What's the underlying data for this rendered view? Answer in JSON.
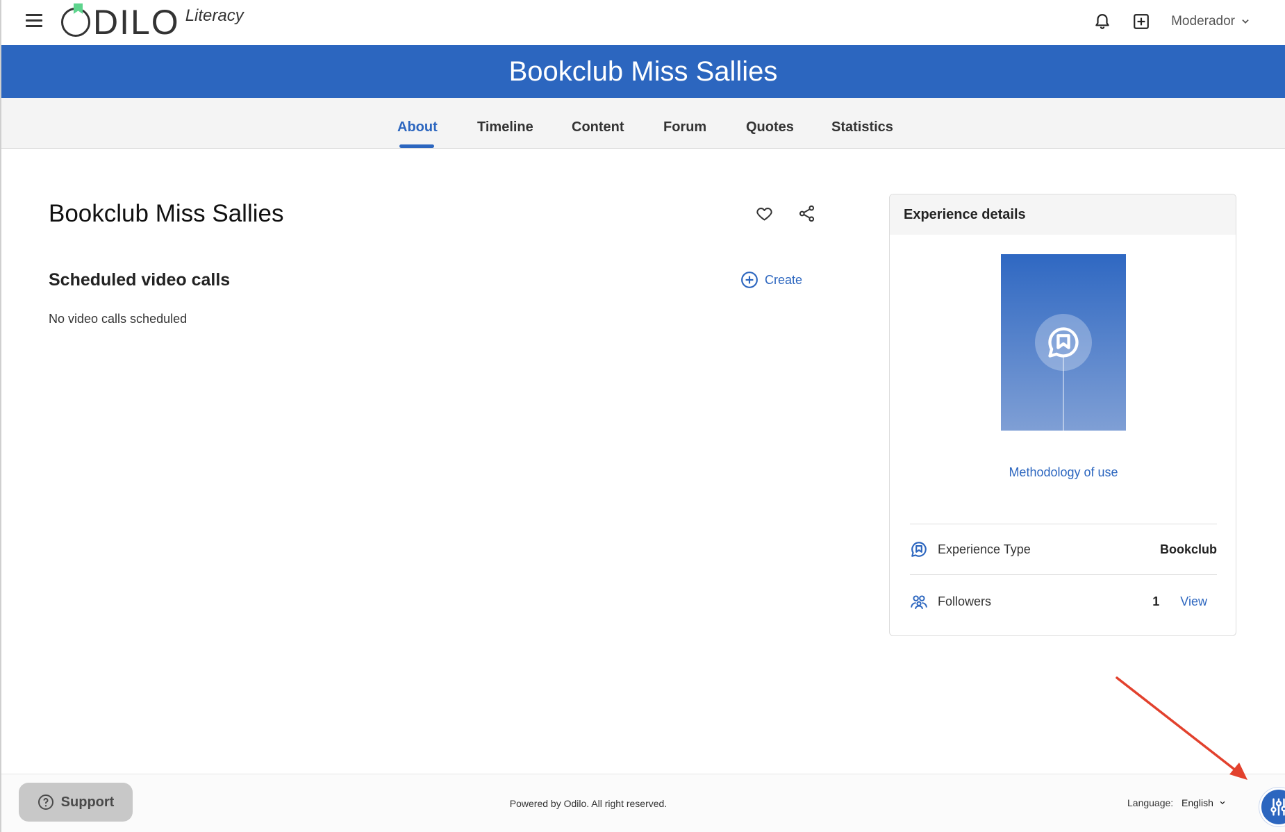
{
  "header": {
    "logo_text": "ODILO",
    "logo_sub": "Literacy",
    "user_label": "Moderador"
  },
  "banner": {
    "title": "Bookclub Miss Sallies"
  },
  "tabs": [
    {
      "label": "About",
      "active": true
    },
    {
      "label": "Timeline",
      "active": false
    },
    {
      "label": "Content",
      "active": false
    },
    {
      "label": "Forum",
      "active": false
    },
    {
      "label": "Quotes",
      "active": false
    },
    {
      "label": "Statistics",
      "active": false
    }
  ],
  "main": {
    "title": "Bookclub Miss Sallies",
    "section_title": "Scheduled video calls",
    "create_label": "Create",
    "empty_message": "No video calls scheduled"
  },
  "card": {
    "title": "Experience details",
    "methodology_link": "Methodology of use",
    "rows": [
      {
        "label": "Experience Type",
        "value": "Bookclub"
      },
      {
        "label": "Followers",
        "value": "1",
        "action": "View"
      }
    ]
  },
  "footer": {
    "support_label": "Support",
    "note": "Powered by Odilo. All right reserved.",
    "language_label": "Language:",
    "language_value": "English"
  },
  "colors": {
    "brand_blue": "#2c66bf",
    "logo_green": "#5ed48d",
    "annotation_red": "#e2412d"
  },
  "icons": [
    "menu-icon",
    "bell-icon",
    "add-box-icon",
    "chevron-down-icon",
    "heart-icon",
    "share-icon",
    "add-circle-icon",
    "chat-bookmark-icon",
    "people-icon",
    "help-circle-icon",
    "sliders-icon"
  ]
}
